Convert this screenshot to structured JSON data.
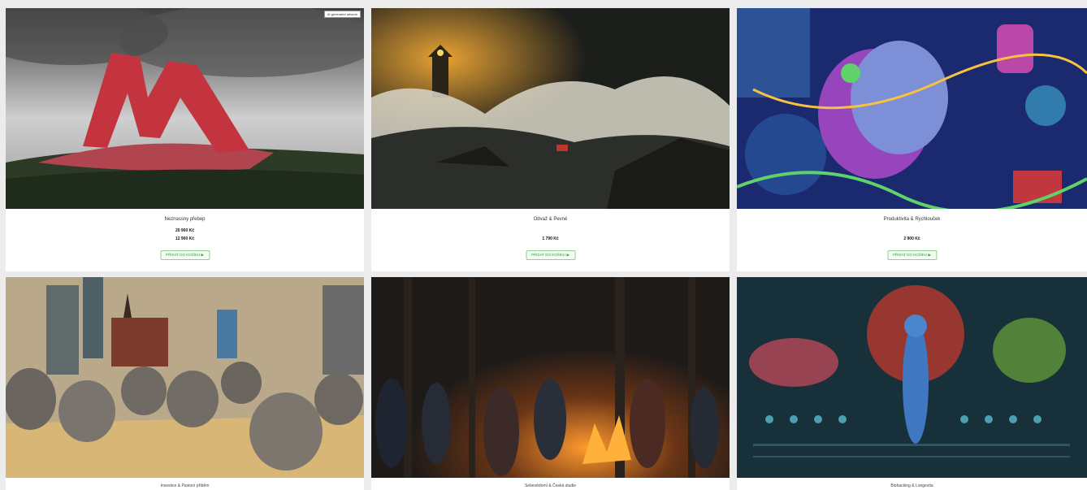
{
  "cards": [
    {
      "title": "Neznassny přebep",
      "prices": [
        "20 900 Kč",
        "12 900 Kč"
      ],
      "button": "PŘIDAT DO KOŠÍKU ▶",
      "badge": "AI generated artwork"
    },
    {
      "title": "Odvaž & Pevné",
      "prices": [
        "1 790 Kč"
      ],
      "button": "PŘIDAT DO KOŠÍKU ▶"
    },
    {
      "title": "Produktivita & Rychlouček",
      "prices": [
        "2 900 Kč"
      ],
      "button": "PŘIDAT DO KOŠÍKU ▶"
    },
    {
      "caption": "Investice & Pastoní příběm"
    },
    {
      "caption": "Sebevědomí & Česká studie"
    },
    {
      "caption": "Biohacking & Longevita"
    }
  ]
}
